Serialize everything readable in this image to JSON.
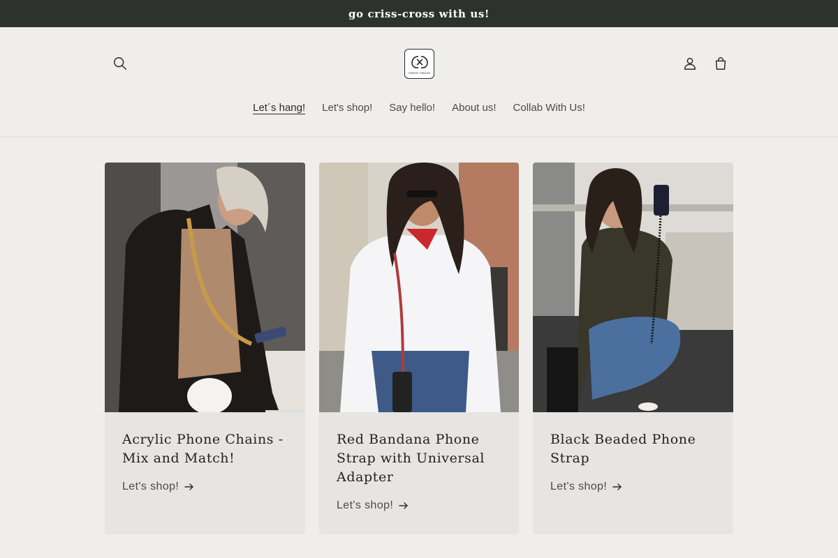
{
  "announcement": {
    "text": "go criss-cross with us!"
  },
  "header": {
    "logo_text": "CRISS-CROSS",
    "nav": [
      {
        "label": "Let´s hang!",
        "active": true
      },
      {
        "label": "Let's shop!"
      },
      {
        "label": "Say hello!"
      },
      {
        "label": "About us!"
      },
      {
        "label": "Collab With Us!"
      }
    ],
    "icons": [
      "search-icon",
      "account-icon",
      "cart-icon"
    ]
  },
  "cards": [
    {
      "title": "Acrylic Phone Chains - Mix and Match!",
      "link": "Let's shop!"
    },
    {
      "title": "Red Bandana Phone Strap with Universal Adapter",
      "link": "Let's shop!"
    },
    {
      "title": "Black Beaded Phone Strap",
      "link": "Let's shop!"
    }
  ],
  "colors": {
    "announcement_bg": "#2d322f",
    "page_bg": "#efeeec",
    "card_bg": "#e6e5e2"
  }
}
